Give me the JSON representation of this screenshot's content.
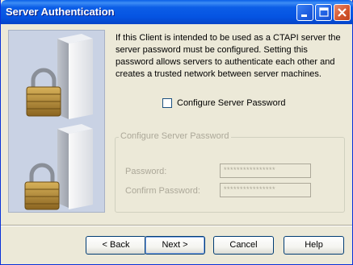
{
  "window": {
    "title": "Server Authentication"
  },
  "description": "If this Client is intended to be used as a CTAPI server the server password must be configured. Setting this password allows servers to authenticate each other and creates a trusted network between server machines.",
  "configure_checkbox": {
    "label": "Configure Server Password",
    "checked": false
  },
  "group": {
    "legend": "Configure Server Password",
    "password_label": "Password:",
    "password_value": "****************",
    "confirm_label": "Confirm Password:",
    "confirm_value": "****************"
  },
  "buttons": {
    "back": "< Back",
    "next": "Next >",
    "cancel": "Cancel",
    "help": "Help"
  }
}
